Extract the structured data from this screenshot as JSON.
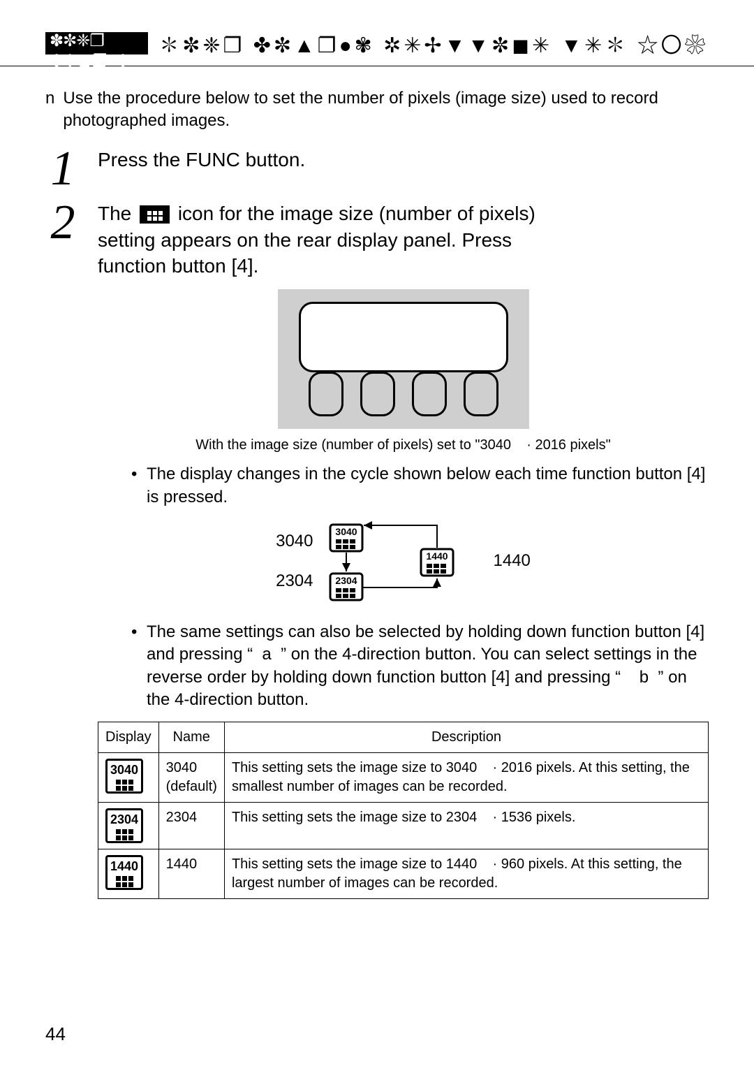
{
  "header_symbols": "✽✼❈❐ ✤✼▲❐●✾ ✲✳✢▼▼✼◼✳ ▼✳✽ ☆〇❀✳✽ ✳✼▮✽ ✢✯◆〇❂✽",
  "intro_bullet_mark": "n",
  "intro": "Use the procedure below to set the number of pixels (image size) used to record photographed images.",
  "step1": "Press the  FUNC  button.",
  "step2_pre": "The",
  "step2_post_line1": "icon for the image size (number of pixels)",
  "step2_line2": "setting appears on the rear display panel. Press",
  "step2_line3": "function button [4].",
  "caption": "With the image size (number of pixels) set to \"3040    ·  2016 pixels\"",
  "bullet1": "The display changes in the cycle shown below each time function button [4] is pressed.",
  "cycle_left_a": "3040",
  "cycle_left_b": "2304",
  "cycle_right": "1440",
  "bullet2": "The same settings can also be selected by holding down function button [4] and pressing “  a  ” on the 4-direction button. You can select settings in the reverse order by holding down function button [4] and pressing “    b  ” on the 4-direction button.",
  "table": {
    "headers": [
      "Display",
      "Name",
      "Description"
    ],
    "rows": [
      {
        "disp": "3040",
        "name_line1": "3040",
        "name_line2": "(default)",
        "desc": "This setting sets the image size to 3040    ·  2016 pixels. At this setting, the smallest number of images can be recorded."
      },
      {
        "disp": "2304",
        "name_line1": "2304",
        "name_line2": "",
        "desc": "This setting sets the image size to 2304    ·  1536 pixels."
      },
      {
        "disp": "1440",
        "name_line1": "1440",
        "name_line2": "",
        "desc": "This setting sets the image size to 1440    ·  960 pixels. At this setting, the largest number of images can be recorded."
      }
    ]
  },
  "page_number": "44"
}
